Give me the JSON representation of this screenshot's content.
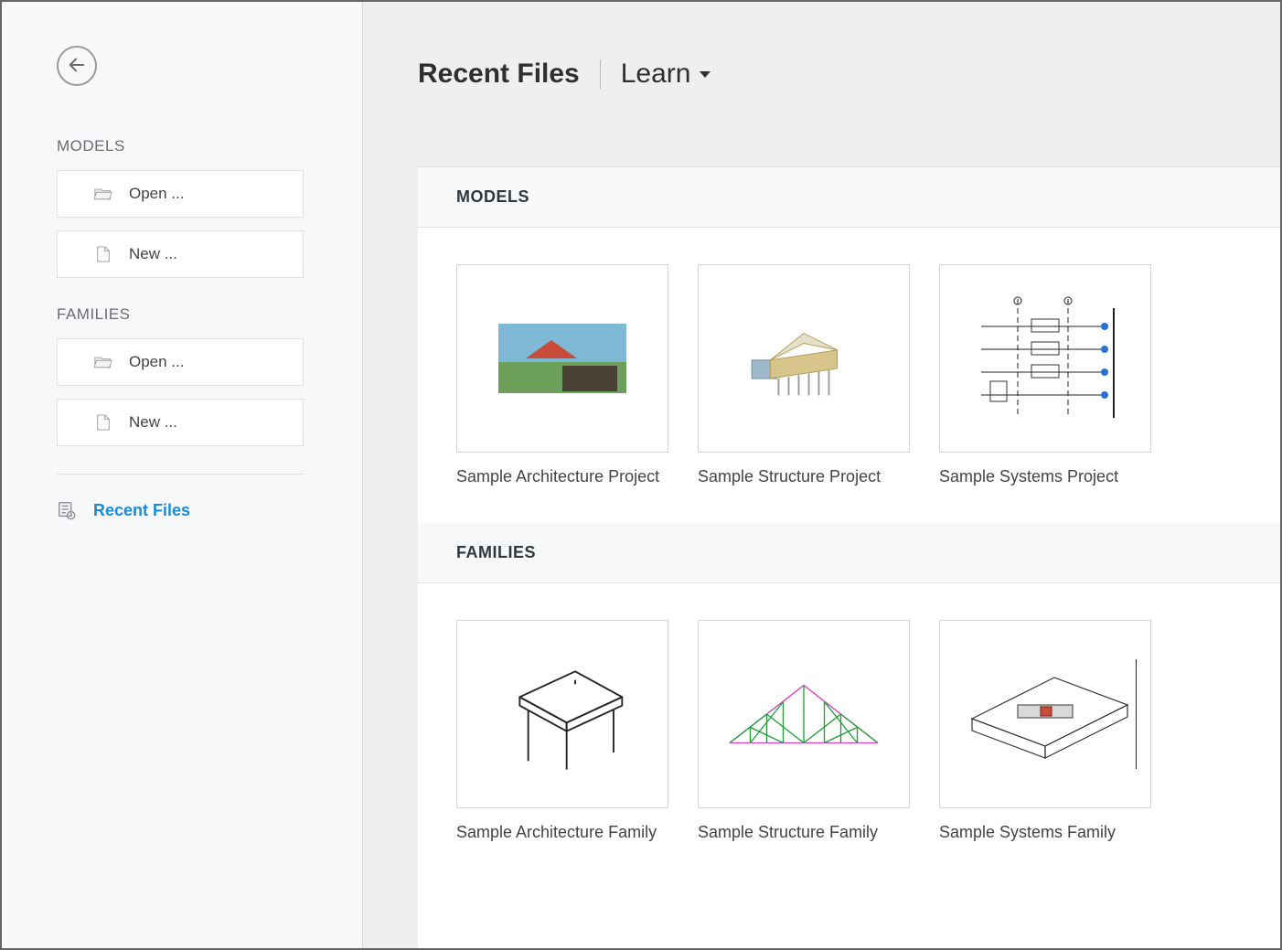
{
  "sidebar": {
    "sections": [
      {
        "label": "MODELS",
        "buttons": [
          {
            "icon": "folder-open",
            "label": "Open ..."
          },
          {
            "icon": "file-new",
            "label": "New ..."
          }
        ]
      },
      {
        "label": "FAMILIES",
        "buttons": [
          {
            "icon": "folder-open",
            "label": "Open ..."
          },
          {
            "icon": "file-new",
            "label": "New ..."
          }
        ]
      }
    ],
    "recent_link_label": "Recent Files"
  },
  "header": {
    "tabs": [
      {
        "label": "Recent Files",
        "active": true,
        "dropdown": false
      },
      {
        "label": "Learn",
        "active": false,
        "dropdown": true
      }
    ]
  },
  "content": {
    "sections": [
      {
        "title": "MODELS",
        "cards": [
          {
            "label": "Sample Architecture Project",
            "thumb": "arch-project"
          },
          {
            "label": "Sample Structure Project",
            "thumb": "structure-project"
          },
          {
            "label": "Sample Systems Project",
            "thumb": "systems-project"
          }
        ]
      },
      {
        "title": "FAMILIES",
        "cards": [
          {
            "label": "Sample Architecture Family",
            "thumb": "arch-family"
          },
          {
            "label": "Sample Structure Family",
            "thumb": "structure-family"
          },
          {
            "label": "Sample Systems Family",
            "thumb": "systems-family"
          }
        ]
      }
    ]
  }
}
